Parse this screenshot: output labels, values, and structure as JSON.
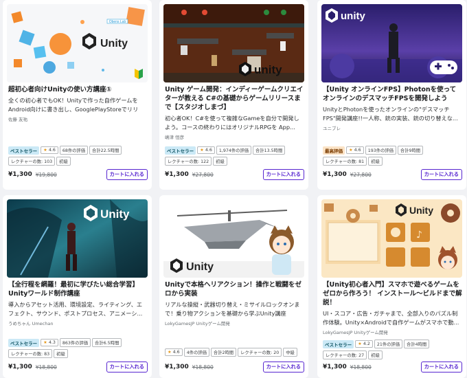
{
  "cards": [
    {
      "title": "超初心者向けUnityの使い方講座①",
      "description": "全くの初心者でもOK！Unityで作った自作ゲームをAndroid向けに書き出し、GooglePlayStoreでリリー...",
      "author": "佐藤 友祐",
      "badge": "ベストセラー",
      "rating": "4.6",
      "reviews": "68件の評価",
      "hours": "合計22.5時間",
      "lectures": "レクチャーの数: 103",
      "level": "初級",
      "price": "¥1,300",
      "original_price": "¥19,800",
      "cart_label": "カートに入れる",
      "thumb_text": "Unity",
      "thumb_sub": "Obens Lab"
    },
    {
      "title": "Unity ゲーム開発：インディーゲームクリエイターが教える C#の基礎からゲームリリースまで【スタジオしまづ】",
      "description": "初心者OK！C#を使って複雑なGameを自分で開発しよう。コースの終わりにはオリジナルRPGを App...",
      "author": "嶋津 恒彦",
      "badge": "ベストセラー",
      "rating": "4.6",
      "reviews": "1,974件の評価",
      "hours": "合計13.5時間",
      "lectures": "レクチャーの数: 122",
      "level": "初級",
      "price": "¥1,300",
      "original_price": "¥27,800",
      "cart_label": "カートに入れる",
      "thumb_text": "unity"
    },
    {
      "title": "【Unity オンラインFPS】Photonを使ってオンラインのデスマッチFPSを開発しよう",
      "description": "UnityとPhotonを使ったオンラインの\"デスマッチFPS\"開発講座!!一人称、銃の実装、銃の切り替えな...",
      "author": "ユニブレ",
      "badge": "最高評価",
      "rating": "4.6",
      "reviews": "193件の評価",
      "hours": "合計9時間",
      "lectures": "レクチャーの数: 81",
      "level": "初級",
      "price": "¥1,300",
      "original_price": "¥27,800",
      "cart_label": "カートに入れる",
      "thumb_text": "unity"
    },
    {
      "title": "【全行程を網羅！最初に学びたい総合学習】Unityワールド制作講座",
      "description": "導入からアセット活用、環境設定、ライティング、エフェクト、サウンド、ポストプロセス、アニメーシ...",
      "author": "うめちゃん Umechan",
      "badge": "ベストセラー",
      "rating": "4.3",
      "reviews": "863件の評価",
      "hours": "合計6.5時間",
      "lectures": "レクチャーの数: 83",
      "level": "初級",
      "price": "¥1,300",
      "original_price": "¥18,800",
      "cart_label": "カートに入れる",
      "thumb_text": "Unity"
    },
    {
      "title": "Unityで本格ヘリアクション！操作と戦闘をゼロから実装",
      "description": "リアルな操縦・武器切り替え・ミサイルロックオンまで！乗り物アクションを基礎から学ぶUnity講座",
      "author": "LokyGamesJP Unityゲーム開発",
      "badge": "",
      "rating": "4.6",
      "reviews": "4件の評価",
      "hours": "合計2時間",
      "lectures": "レクチャーの数: 20",
      "level": "中級",
      "price": "¥1,300",
      "original_price": "¥18,800",
      "cart_label": "カートに入れる",
      "thumb_text": "Unity"
    },
    {
      "title": "【Unity初心者入門】スマホで遊べるゲームをゼロから作ろう！ インストール〜ビルドまで解説！",
      "description": "UI・スコア・広告・ガチャまで、全部入りのパズル制作体験。Unity×Androidで自作ゲームがスマホで動...",
      "author": "LokyGamesJP Unityゲーム開発",
      "badge": "ベストセラー",
      "rating": "4.2",
      "reviews": "21件の評価",
      "hours": "合計4時間",
      "lectures": "レクチャーの数: 27",
      "level": "初級",
      "price": "¥1,300",
      "original_price": "¥18,800",
      "cart_label": "カートに入れる",
      "thumb_text": "Unity"
    }
  ],
  "colors": {
    "accent": "#5624d0",
    "badge_best": "#cbe9f6",
    "badge_high": "#fbe3c6",
    "star": "#e59819"
  },
  "icons": [
    "unity-logo-icon",
    "beginner-mark-icon",
    "gamepad-icon",
    "star-icon"
  ]
}
